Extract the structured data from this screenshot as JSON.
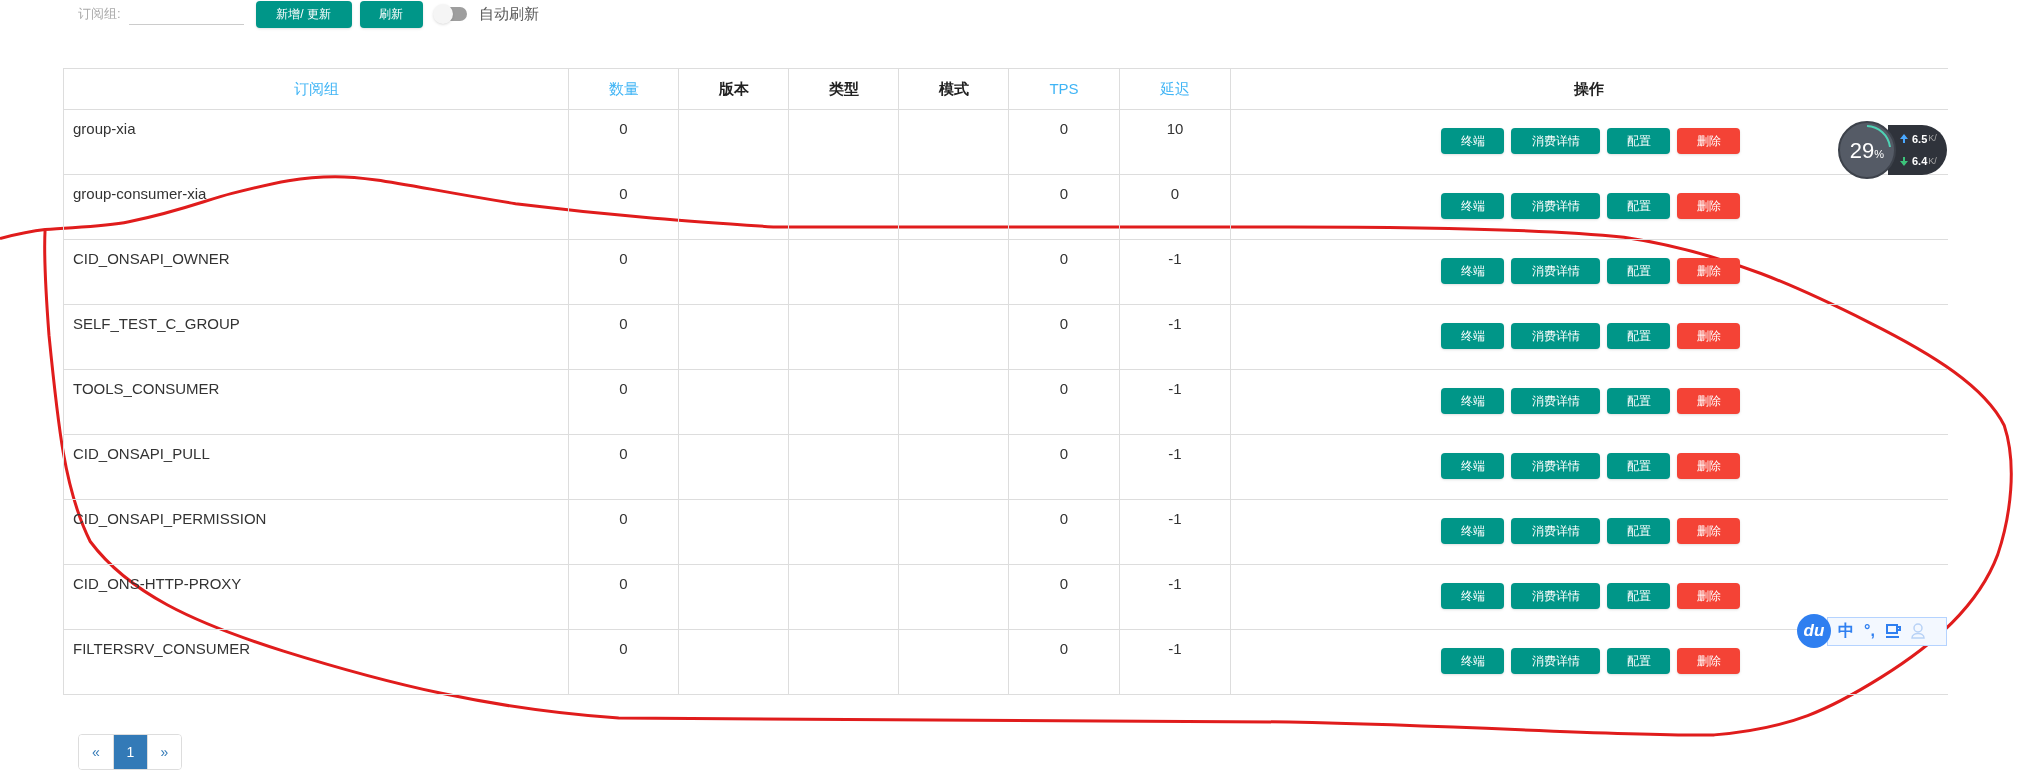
{
  "toolbar": {
    "field_label": "订阅组:",
    "buttons": [
      "新增/ 更新",
      "刷新"
    ],
    "auto_refresh": {
      "label": "自动刷新",
      "on": false
    }
  },
  "table": {
    "columns": [
      {
        "label": "订阅组",
        "sortable": true
      },
      {
        "label": "数量",
        "sortable": true
      },
      {
        "label": "版本",
        "sortable": false
      },
      {
        "label": "类型",
        "sortable": false
      },
      {
        "label": "模式",
        "sortable": false
      },
      {
        "label": "TPS",
        "sortable": true
      },
      {
        "label": "延迟",
        "sortable": true
      },
      {
        "label": "操作",
        "sortable": false
      }
    ],
    "rows": [
      {
        "group": "group-xia",
        "count": "0",
        "tps": "0",
        "delay": "10",
        "actions": [
          {
            "label": "终端",
            "kind": "primary"
          },
          {
            "label": "消费详情",
            "kind": "primary"
          },
          {
            "label": "配置",
            "kind": "primary"
          },
          {
            "label": "删除",
            "kind": "danger"
          }
        ]
      },
      {
        "group": "group-consumer-xia",
        "count": "0",
        "tps": "0",
        "delay": "0",
        "actions": [
          {
            "label": "终端",
            "kind": "primary"
          },
          {
            "label": "消费详情",
            "kind": "primary"
          },
          {
            "label": "配置",
            "kind": "primary"
          },
          {
            "label": "删除",
            "kind": "danger"
          }
        ]
      },
      {
        "group": "CID_ONSAPI_OWNER",
        "count": "0",
        "tps": "0",
        "delay": "-1",
        "actions": [
          {
            "label": "终端",
            "kind": "primary"
          },
          {
            "label": "消费详情",
            "kind": "primary"
          },
          {
            "label": "配置",
            "kind": "primary"
          },
          {
            "label": "删除",
            "kind": "danger"
          }
        ]
      },
      {
        "group": "SELF_TEST_C_GROUP",
        "count": "0",
        "tps": "0",
        "delay": "-1",
        "actions": [
          {
            "label": "终端",
            "kind": "primary"
          },
          {
            "label": "消费详情",
            "kind": "primary"
          },
          {
            "label": "配置",
            "kind": "primary"
          },
          {
            "label": "删除",
            "kind": "danger"
          }
        ]
      },
      {
        "group": "TOOLS_CONSUMER",
        "count": "0",
        "tps": "0",
        "delay": "-1",
        "actions": [
          {
            "label": "终端",
            "kind": "primary"
          },
          {
            "label": "消费详情",
            "kind": "primary"
          },
          {
            "label": "配置",
            "kind": "primary"
          },
          {
            "label": "删除",
            "kind": "danger"
          }
        ]
      },
      {
        "group": "CID_ONSAPI_PULL",
        "count": "0",
        "tps": "0",
        "delay": "-1",
        "actions": [
          {
            "label": "终端",
            "kind": "primary"
          },
          {
            "label": "消费详情",
            "kind": "primary"
          },
          {
            "label": "配置",
            "kind": "primary"
          },
          {
            "label": "删除",
            "kind": "danger"
          }
        ]
      },
      {
        "group": "CID_ONSAPI_PERMISSION",
        "count": "0",
        "tps": "0",
        "delay": "-1",
        "actions": [
          {
            "label": "终端",
            "kind": "primary"
          },
          {
            "label": "消费详情",
            "kind": "primary"
          },
          {
            "label": "配置",
            "kind": "primary"
          },
          {
            "label": "删除",
            "kind": "danger"
          }
        ]
      },
      {
        "group": "CID_ONS-HTTP-PROXY",
        "count": "0",
        "tps": "0",
        "delay": "-1",
        "actions": [
          {
            "label": "终端",
            "kind": "primary"
          },
          {
            "label": "消费详情",
            "kind": "primary"
          },
          {
            "label": "配置",
            "kind": "primary"
          },
          {
            "label": "删除",
            "kind": "danger"
          }
        ]
      },
      {
        "group": "FILTERSRV_CONSUMER",
        "count": "0",
        "tps": "0",
        "delay": "-1",
        "actions": [
          {
            "label": "终端",
            "kind": "primary"
          },
          {
            "label": "消费详情",
            "kind": "primary"
          },
          {
            "label": "配置",
            "kind": "primary"
          },
          {
            "label": "删除",
            "kind": "danger"
          }
        ]
      }
    ]
  },
  "pagination": [
    {
      "label": "«",
      "selected": false
    },
    {
      "label": "1",
      "selected": true
    },
    {
      "label": "»",
      "selected": false
    }
  ],
  "speed_widget": {
    "percent": "29",
    "percent_sign": "%",
    "up": "6.5",
    "up_unit": "K/",
    "down": "6.4",
    "down_unit": "K/"
  },
  "ime_bar": {
    "logo": "du",
    "mode": "中",
    "punctuation": "°,"
  }
}
